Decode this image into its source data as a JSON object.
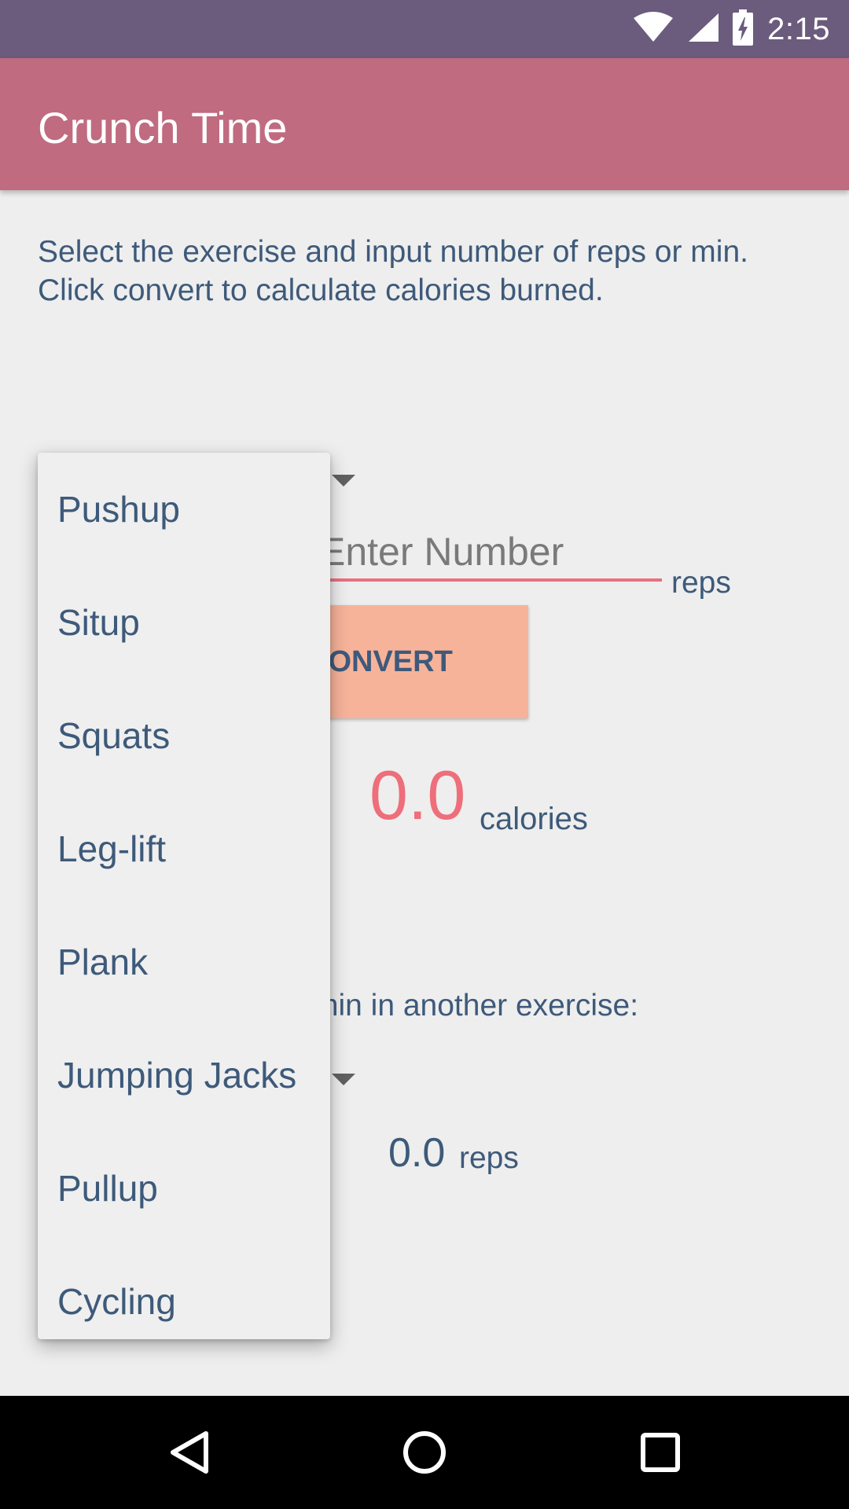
{
  "status_bar": {
    "time": "2:15",
    "icons": [
      "wifi-icon",
      "cell-signal-icon",
      "battery-charging-icon"
    ]
  },
  "app_bar": {
    "title": "Crunch Time"
  },
  "main": {
    "instructions": "Select the exercise and input number of reps or min. Click convert to calculate calories burned.",
    "input": {
      "placeholder": "Enter Number",
      "value": "",
      "unit": "reps"
    },
    "convert_label": "CONVERT",
    "calories": {
      "value": "0.0",
      "label": "calories"
    },
    "equivalent_prompt": "min in another exercise:",
    "equivalent": {
      "value": "0.0",
      "unit": "reps"
    }
  },
  "dropdown": {
    "items": [
      "Pushup",
      "Situp",
      "Squats",
      "Leg-lift",
      "Plank",
      "Jumping Jacks",
      "Pullup",
      "Cycling"
    ]
  },
  "nav_bar": {
    "buttons": [
      "back-icon",
      "home-icon",
      "recents-icon"
    ]
  },
  "colors": {
    "status_bar": "#6b5b7d",
    "app_bar": "#c06b80",
    "accent": "#ee6e7a",
    "button": "#f7b39a",
    "text": "#3e5a7a",
    "background": "#eeeeee"
  }
}
